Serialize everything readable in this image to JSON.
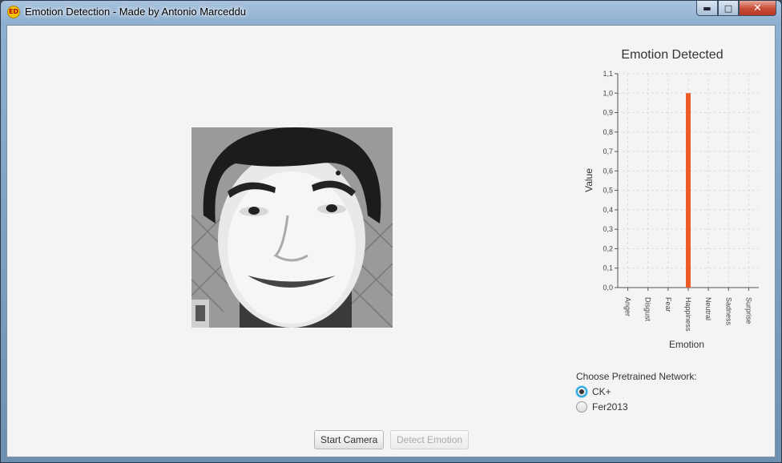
{
  "window": {
    "title": "Emotion Detection - Made by Antonio Marceddu",
    "icon_text": "ED",
    "controls": [
      "minimize-icon",
      "maximize-icon",
      "close-icon"
    ]
  },
  "camera": {
    "image_description": "face-photo"
  },
  "chart_data": {
    "type": "bar",
    "title": "Emotion Detected",
    "xlabel": "Emotion",
    "ylabel": "Value",
    "categories": [
      "Anger",
      "Disgust",
      "Fear",
      "Happiness",
      "Neutral",
      "Sadness",
      "Surprise"
    ],
    "values": [
      0,
      0,
      0,
      1.0,
      0,
      0,
      0
    ],
    "ylim": [
      0,
      1.1
    ],
    "yticks": [
      "0,0",
      "0,1",
      "0,2",
      "0,3",
      "0,4",
      "0,5",
      "0,6",
      "0,7",
      "0,8",
      "0,9",
      "1,0",
      "1,1"
    ],
    "grid": true,
    "bar_color": "#f05a28"
  },
  "network": {
    "label": "Choose Pretrained Network:",
    "options": [
      {
        "label": "CK+",
        "selected": true
      },
      {
        "label": "Fer2013",
        "selected": false
      }
    ]
  },
  "buttons": {
    "start_camera": "Start Camera",
    "detect_emotion": "Detect Emotion"
  }
}
